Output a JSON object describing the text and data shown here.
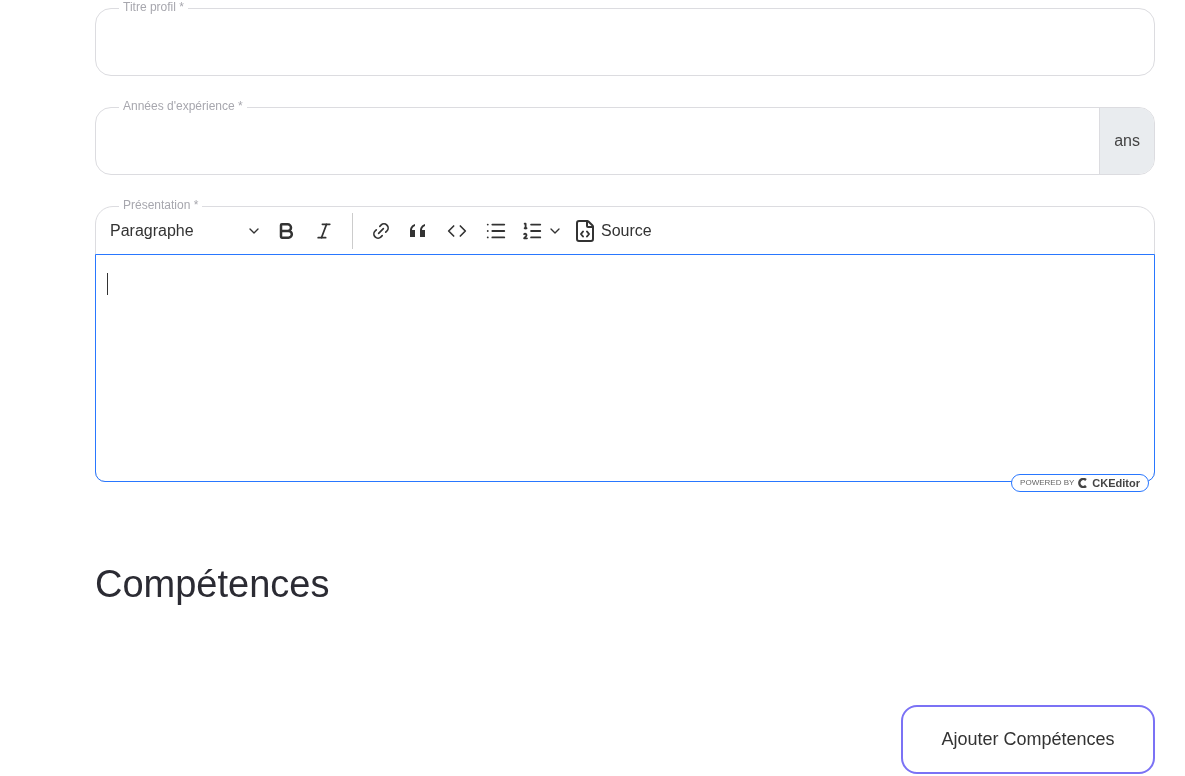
{
  "fields": [
    {
      "label": "Titre profil *"
    },
    {
      "label": "Années d'expérience *",
      "suffix": "ans"
    }
  ],
  "editor": {
    "label": "Présentation *",
    "toolbar": [
      {
        "kind": "heading",
        "label": "Paragraphe"
      },
      {
        "kind": "bold"
      },
      {
        "kind": "italic"
      },
      {
        "kind": "separator"
      },
      {
        "kind": "link"
      },
      {
        "kind": "quote"
      },
      {
        "kind": "code"
      },
      {
        "kind": "bullets"
      },
      {
        "kind": "numbered"
      },
      {
        "kind": "source",
        "label": "Source"
      }
    ],
    "focused": true,
    "badge": {
      "prefix": "POWERED BY",
      "brand": "CKEditor"
    }
  },
  "section_title": "Compétences",
  "add_button": "Ajouter Compétences"
}
